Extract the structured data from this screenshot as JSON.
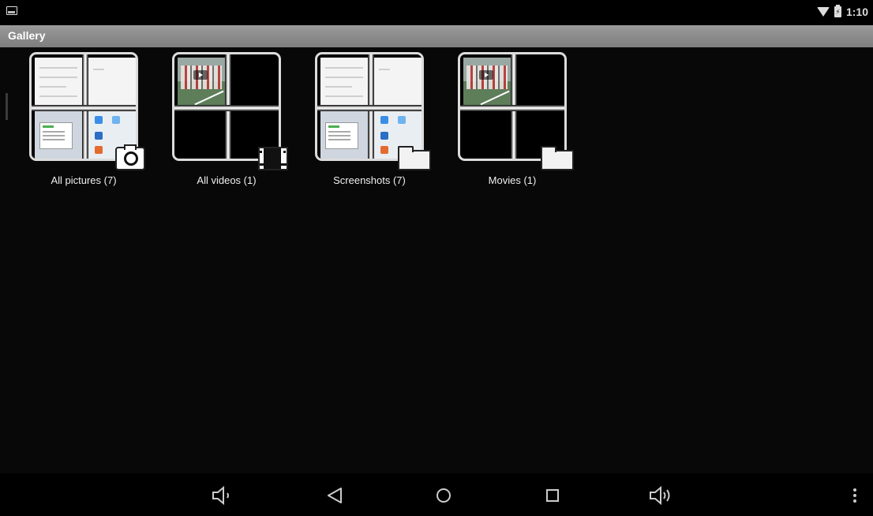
{
  "status_bar": {
    "left_icon": "gallery-notification-icon",
    "wifi_icon": "wifi-icon",
    "battery_icon": "battery-charging-icon",
    "time": "1:10"
  },
  "app": {
    "title": "Gallery"
  },
  "albums": [
    {
      "label": "All pictures (7)",
      "badge": "camera-icon"
    },
    {
      "label": "All videos (1)",
      "badge": "film-icon"
    },
    {
      "label": "Screenshots (7)",
      "badge": "folder-icon"
    },
    {
      "label": "Movies (1)",
      "badge": "folder-icon"
    }
  ],
  "nav_bar": {
    "buttons": [
      "volume-down-icon",
      "back-icon",
      "home-icon",
      "recents-icon",
      "volume-up-icon",
      "overflow-menu-icon"
    ]
  }
}
